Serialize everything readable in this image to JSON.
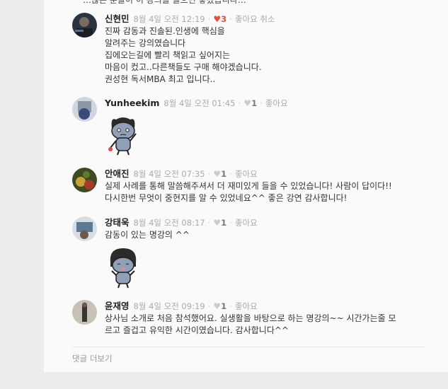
{
  "top_partial_text": "…많은 분들이 이 강의를 들으면 좋겠습니다…",
  "comments": [
    {
      "author": "신현민",
      "date": "8월 4일 오전 12:19",
      "likes": "3",
      "liked": true,
      "like_label": "좋아요 취소",
      "text": "진짜 감동과 진솔된.인생에 핵심을\n알려주는 강의였습니다\n집에오는길에 빨리 책읽고 싶어지는\n마음이 컸고..다른책들도 구매 해야겠습니다.\n권성현 독서MBA  최고 입니다.."
    },
    {
      "author": "Yunheekim",
      "date": "8월 4일 오전 01:45",
      "likes": "1",
      "liked": false,
      "like_label": "좋아요",
      "text": ""
    },
    {
      "author": "안애진",
      "date": "8월 4일 오전 07:35",
      "likes": "1",
      "liked": false,
      "like_label": "좋아요",
      "text": "실제 사례를 통해 말씀해주셔서 더 재미있게 들을 수 있었습니다! 사람이 답이다!!\n다시한번 무엇이 중현지를 알 수 있었네요^^ 좋은 강연 감사합니다!"
    },
    {
      "author": "강태욱",
      "date": "8월 4일 오전 08:17",
      "likes": "1",
      "liked": false,
      "like_label": "좋아요",
      "text": "감동이 있는 명강의 ^^"
    },
    {
      "author": "윤재영",
      "date": "8월 4일 오전 09:19",
      "likes": "1",
      "liked": false,
      "like_label": "좋아요",
      "text": "상사님 소개로 처음 참석했어요. 실생활을 바탕으로 하는 명강의~~ 시간가는줄 모\n르고 즐겁고 유익한 시간이였습니다. 감사합니다^^"
    }
  ],
  "load_more": "댓글 더보기",
  "icons": {
    "like": "heart-icon",
    "sticker": "cat-sticker-icon"
  }
}
